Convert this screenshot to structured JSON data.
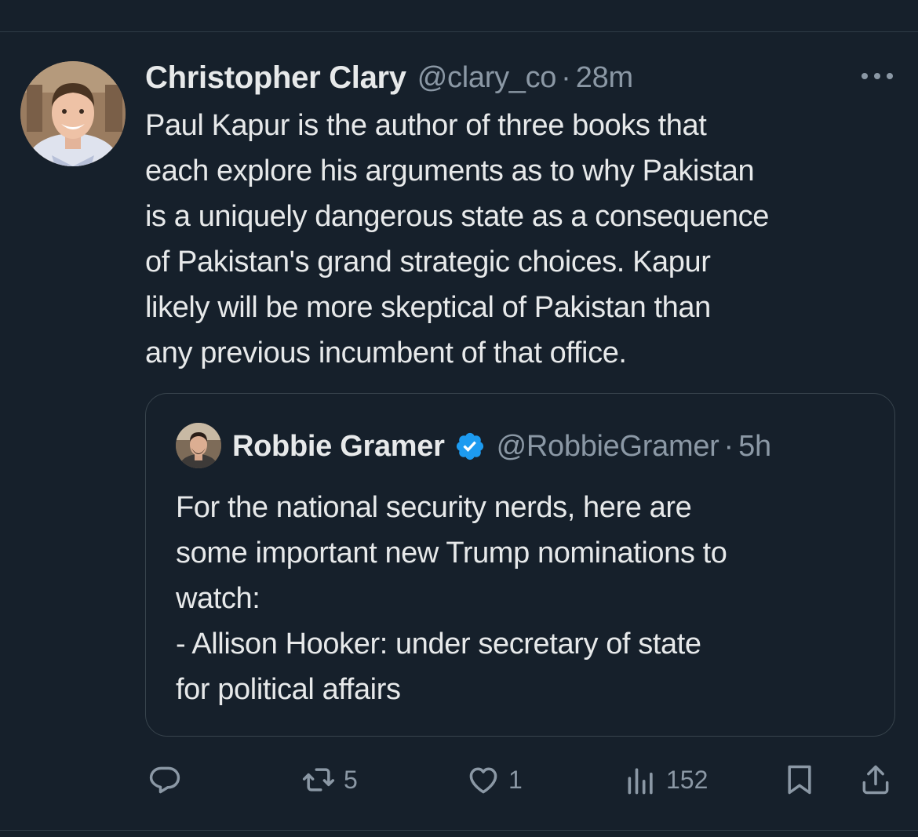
{
  "author": {
    "name": "Christopher Clary",
    "handle": "@clary_co",
    "separator": "·",
    "time": "28m"
  },
  "tweet": {
    "lines": [
      "Paul Kapur is the author of three books that",
      "each explore his arguments as to why Pakistan",
      "is a uniquely dangerous state as a consequence",
      "of Pakistan's grand strategic choices. Kapur",
      "likely will be more skeptical of Pakistan than",
      "any previous incumbent of that office."
    ]
  },
  "quote": {
    "name": "Robbie Gramer",
    "handle": "@RobbieGramer",
    "separator": "·",
    "time": "5h",
    "lines": [
      "For the national security nerds, here are",
      "some important new Trump nominations to",
      "watch:",
      "- Allison Hooker: under secretary of state",
      "for political affairs"
    ]
  },
  "actions": {
    "reply_icon": "reply-icon",
    "retweet_icon": "retweet-icon",
    "retweet_count": "5",
    "like_icon": "heart-icon",
    "like_count": "1",
    "views_icon": "views-icon",
    "views_count": "152",
    "bookmark_icon": "bookmark-icon",
    "share_icon": "share-icon"
  },
  "colors": {
    "background": "#16202b",
    "text": "#e7e9ea",
    "secondary": "#8b98a5",
    "verified": "#1d9bf0",
    "border": "#38444d"
  }
}
